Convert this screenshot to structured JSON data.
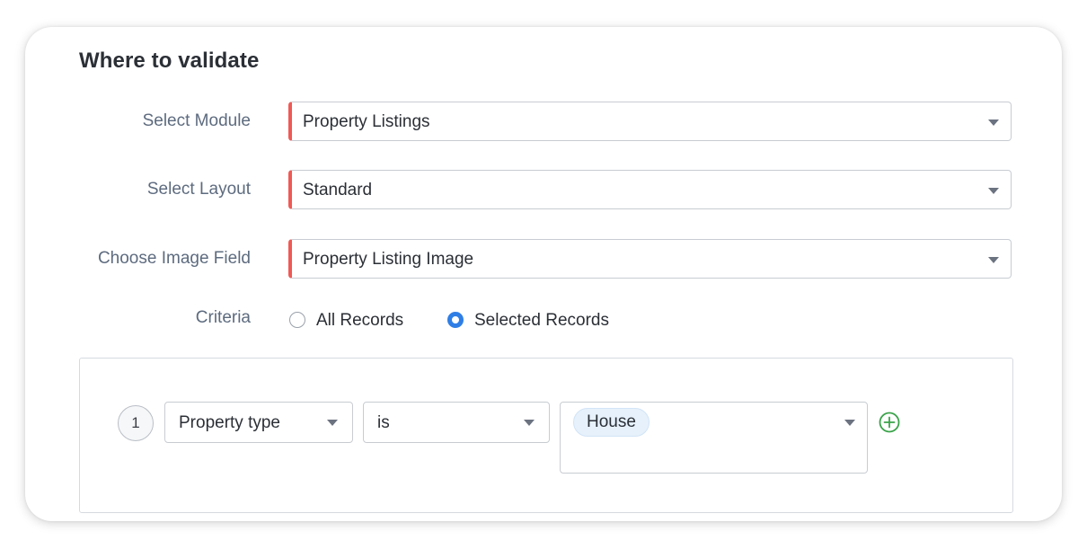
{
  "section": {
    "title": "Where to validate"
  },
  "fields": {
    "module": {
      "label": "Select Module",
      "value": "Property Listings"
    },
    "layout": {
      "label": "Select Layout",
      "value": "Standard"
    },
    "image_field": {
      "label": "Choose Image Field",
      "value": "Property Listing Image"
    }
  },
  "criteria": {
    "label": "Criteria",
    "options": [
      {
        "label": "All Records",
        "selected": false
      },
      {
        "label": "Selected Records",
        "selected": true
      }
    ],
    "rules": [
      {
        "index": "1",
        "field": "Property type",
        "operator": "is",
        "values": [
          "House"
        ]
      }
    ]
  },
  "colors": {
    "mandatory_accent": "#ef5a55",
    "radio_selected": "#2f7ee6",
    "add_icon": "#3aa34a",
    "chip_bg": "#e6f1fb"
  },
  "icons": {
    "dropdown": "caret-down-icon",
    "add": "plus-circle-icon"
  }
}
